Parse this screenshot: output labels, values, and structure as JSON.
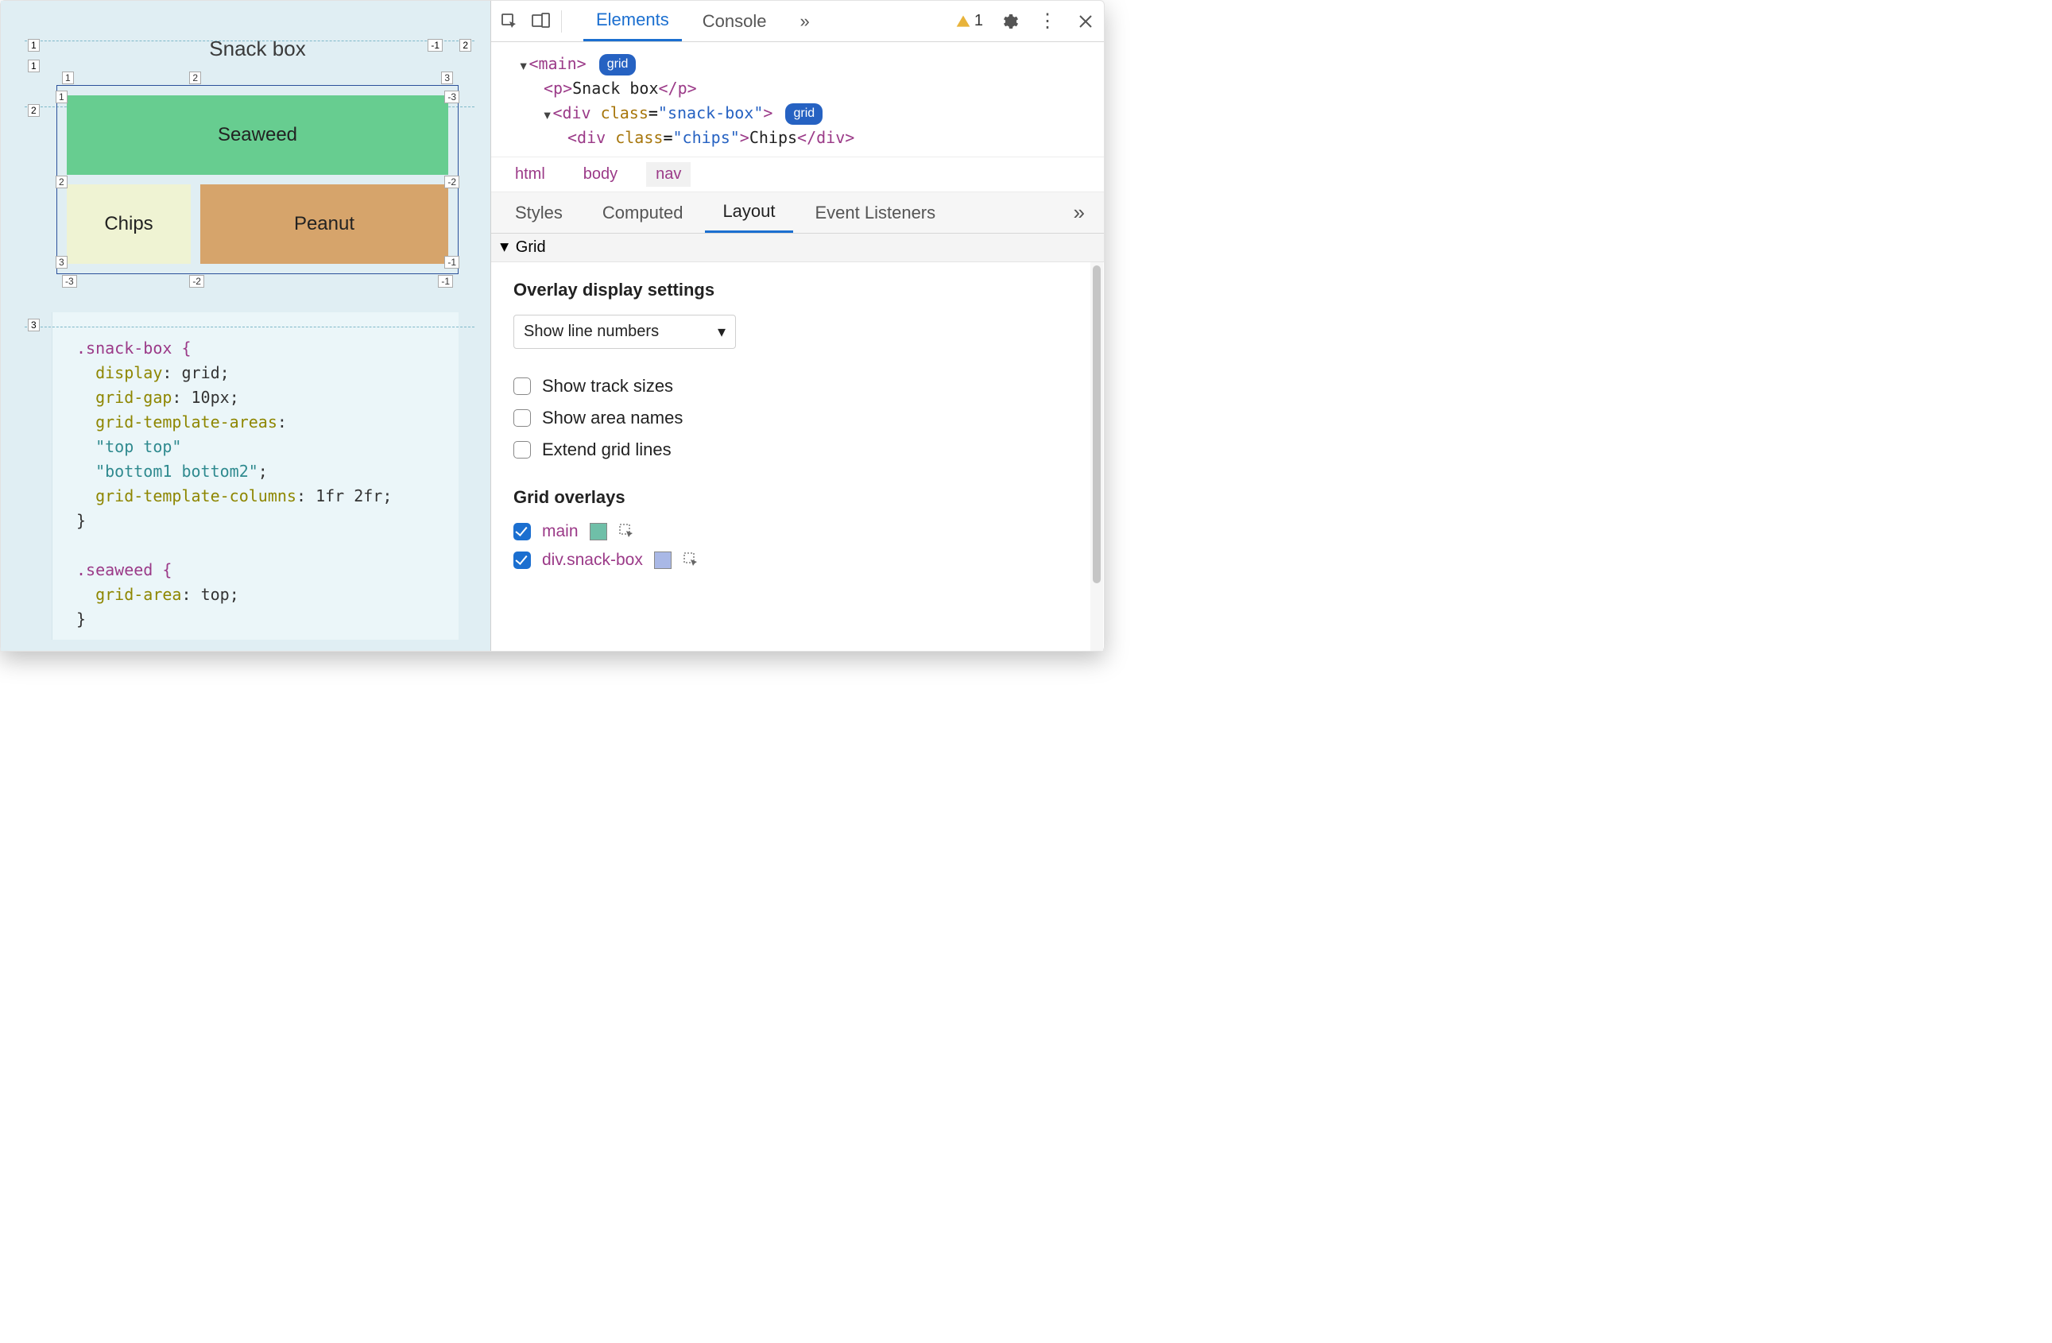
{
  "page": {
    "title": "Snack box",
    "cells": {
      "seaweed": "Seaweed",
      "chips": "Chips",
      "peanut": "Peanut"
    }
  },
  "code": {
    "lines": [
      {
        "t": "sel",
        "v": ".snack-box {"
      },
      {
        "t": "prop",
        "k": "display",
        "v": "grid"
      },
      {
        "t": "prop",
        "k": "grid-gap",
        "v": "10px"
      },
      {
        "t": "prop",
        "k": "grid-template-areas",
        "v": ""
      },
      {
        "t": "str",
        "v": "\"top top\""
      },
      {
        "t": "str",
        "v": "\"bottom1 bottom2\"",
        "suffix": ";"
      },
      {
        "t": "prop",
        "k": "grid-template-columns",
        "v": "1fr 2fr"
      },
      {
        "t": "close",
        "v": "}"
      },
      {
        "t": "blank"
      },
      {
        "t": "sel",
        "v": ".seaweed {"
      },
      {
        "t": "prop",
        "k": "grid-area",
        "v": "top"
      },
      {
        "t": "close",
        "v": "}"
      }
    ]
  },
  "devtools": {
    "tabs": [
      "Elements",
      "Console"
    ],
    "active_tab": "Elements",
    "more_indicator": "»",
    "warning_count": "1",
    "dom": {
      "main_open": "<main>",
      "main_pill": "grid",
      "p_line": "<p>Snack box</p>",
      "div_open": "<div class=\"snack-box\">",
      "div_pill": "grid",
      "child_line": "<div class=\"chips\">Chips</div>"
    },
    "breadcrumbs": [
      "html",
      "body",
      "nav"
    ],
    "breadcrumb_active": "nav",
    "subtabs": [
      "Styles",
      "Computed",
      "Layout",
      "Event Listeners"
    ],
    "subtab_active": "Layout",
    "grid_section_title": "Grid",
    "overlay_settings_heading": "Overlay display settings",
    "select_value": "Show line numbers",
    "checkboxes": [
      {
        "label": "Show track sizes",
        "checked": false
      },
      {
        "label": "Show area names",
        "checked": false
      },
      {
        "label": "Extend grid lines",
        "checked": false
      }
    ],
    "grid_overlays_heading": "Grid overlays",
    "overlays": [
      {
        "name": "main",
        "checked": true,
        "swatch": "#6fbfa8"
      },
      {
        "name": "div.snack-box",
        "checked": true,
        "swatch": "#a9b8e6"
      }
    ]
  },
  "grid_numbers": {
    "outer_left": [
      "1",
      "2",
      "3"
    ],
    "outer_top": [
      "1",
      "-1",
      "2"
    ],
    "inner_top": [
      "1",
      "2",
      "3"
    ],
    "inner_left": [
      "1",
      "2",
      "3"
    ],
    "inner_right_neg": [
      "-3",
      "-2",
      "-1"
    ],
    "inner_bottom_neg": [
      "-3",
      "-2",
      "-1"
    ]
  }
}
